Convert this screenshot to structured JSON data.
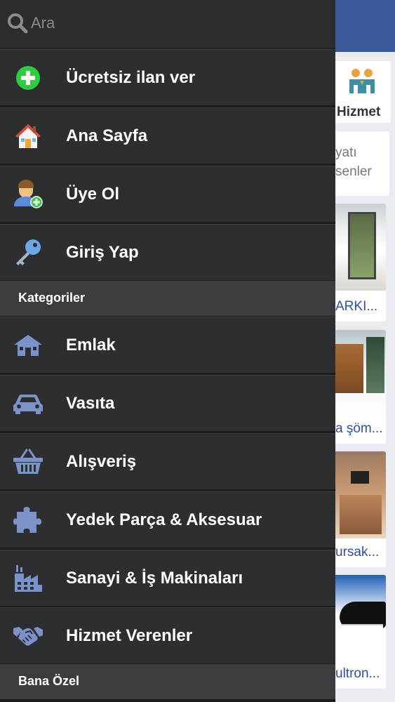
{
  "search": {
    "placeholder": "Ara",
    "icon": "search-icon"
  },
  "menu_top": [
    {
      "label": "Ücretsiz ilan ver",
      "icon": "plus-circle-icon",
      "color": "#2ecc40"
    },
    {
      "label": "Ana Sayfa",
      "icon": "home-icon"
    },
    {
      "label": "Üye Ol",
      "icon": "add-user-icon"
    },
    {
      "label": "Giriş Yap",
      "icon": "key-icon"
    }
  ],
  "sections": {
    "categories_title": "Kategoriler",
    "personal_title": "Bana Özel"
  },
  "categories": [
    {
      "label": "Emlak",
      "icon": "house-icon"
    },
    {
      "label": "Vasıta",
      "icon": "car-icon"
    },
    {
      "label": "Alışveriş",
      "icon": "basket-icon"
    },
    {
      "label": "Yedek Parça & Aksesuar",
      "icon": "puzzle-icon"
    },
    {
      "label": "Sanayi & İş Makinaları",
      "icon": "factory-icon"
    },
    {
      "label": "Hizmet Verenler",
      "icon": "handshake-icon"
    }
  ],
  "background": {
    "hizmet_label": "Hizmet",
    "text_card": {
      "line1": "yatı",
      "line2": "senler"
    },
    "listing_captions": [
      "ARKI...",
      "a şöm...",
      "ursak...",
      "ultron..."
    ]
  },
  "colors": {
    "drawer_bg": "#2c2e30",
    "section_bg": "#3a3c3e",
    "icon_blue": "#7b93c9",
    "header_blue": "#3b5998",
    "link_blue": "#2a4fb0"
  }
}
